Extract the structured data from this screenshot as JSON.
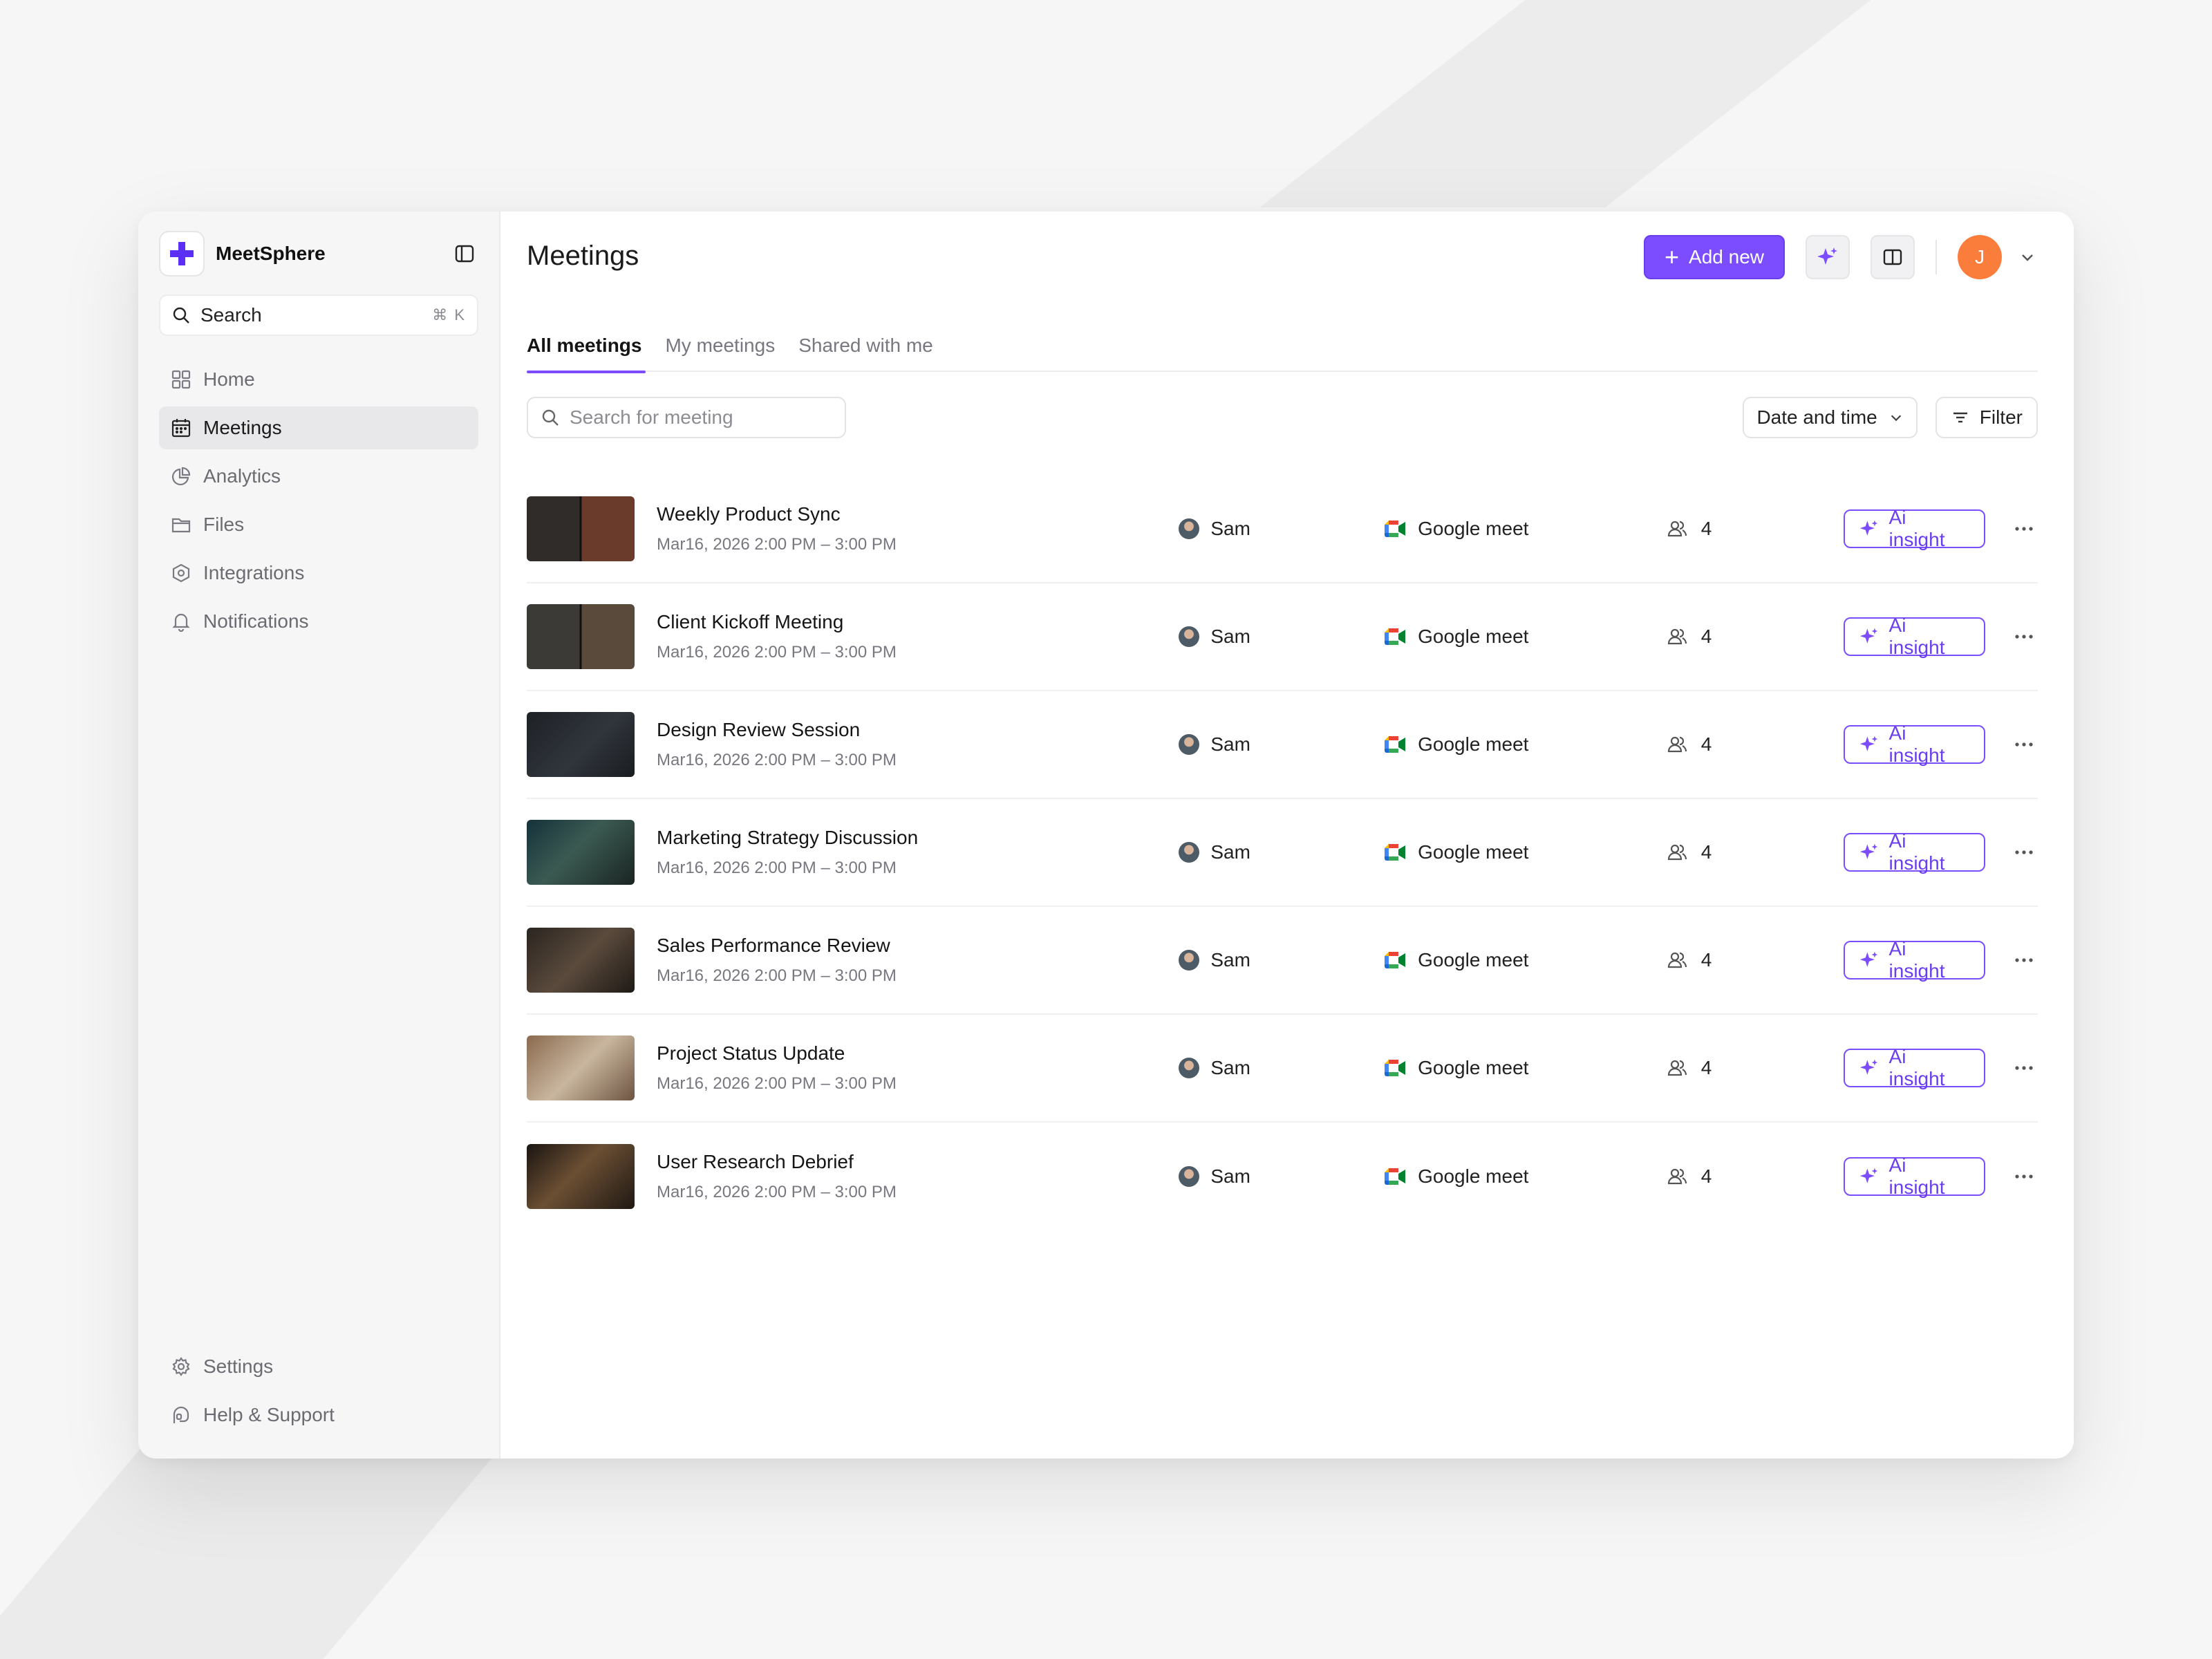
{
  "app": {
    "name": "MeetSphere",
    "accent": "#7c4dff",
    "avatar_color": "#fb7d3c"
  },
  "sidebar": {
    "search_label": "Search",
    "search_shortcut": "⌘ K",
    "items": [
      {
        "label": "Home",
        "icon": "grid-icon"
      },
      {
        "label": "Meetings",
        "icon": "calendar-icon",
        "active": true
      },
      {
        "label": "Analytics",
        "icon": "pie-chart-icon"
      },
      {
        "label": "Files",
        "icon": "folder-icon"
      },
      {
        "label": "Integrations",
        "icon": "hexagon-icon"
      },
      {
        "label": "Notifications",
        "icon": "bell-icon"
      }
    ],
    "bottom": [
      {
        "label": "Settings",
        "icon": "gear-icon"
      },
      {
        "label": "Help & Support",
        "icon": "support-icon"
      }
    ]
  },
  "header": {
    "title": "Meetings",
    "add_label": "Add new",
    "user_initial": "J"
  },
  "tabs": [
    {
      "label": "All meetings",
      "active": true
    },
    {
      "label": "My meetings"
    },
    {
      "label": "Shared with me"
    }
  ],
  "toolbar": {
    "search_placeholder": "Search for meeting",
    "sort_label": "Date and time",
    "filter_label": "Filter"
  },
  "meetings": [
    {
      "title": "Weekly Product Sync",
      "time": "Mar16, 2026  2:00 PM – 3:00 PM",
      "host": "Sam",
      "platform": "Google meet",
      "participants": "4",
      "action": "Ai insight"
    },
    {
      "title": "Client Kickoff Meeting",
      "time": "Mar16, 2026  2:00 PM – 3:00 PM",
      "host": "Sam",
      "platform": "Google meet",
      "participants": "4",
      "action": "Ai insight"
    },
    {
      "title": "Design Review Session",
      "time": "Mar16, 2026  2:00 PM – 3:00 PM",
      "host": "Sam",
      "platform": "Google meet",
      "participants": "4",
      "action": "Ai insight"
    },
    {
      "title": "Marketing Strategy Discussion",
      "time": "Mar16, 2026  2:00 PM – 3:00 PM",
      "host": "Sam",
      "platform": "Google meet",
      "participants": "4",
      "action": "Ai insight"
    },
    {
      "title": "Sales Performance Review",
      "time": "Mar16, 2026  2:00 PM – 3:00 PM",
      "host": "Sam",
      "platform": "Google meet",
      "participants": "4",
      "action": "Ai insight"
    },
    {
      "title": "Project Status Update",
      "time": "Mar16, 2026  2:00 PM – 3:00 PM",
      "host": "Sam",
      "platform": "Google meet",
      "participants": "4",
      "action": "Ai insight"
    },
    {
      "title": "User Research Debrief",
      "time": "Mar16, 2026  2:00 PM – 3:00 PM",
      "host": "Sam",
      "platform": "Google meet",
      "participants": "4",
      "action": "Ai insight"
    }
  ]
}
